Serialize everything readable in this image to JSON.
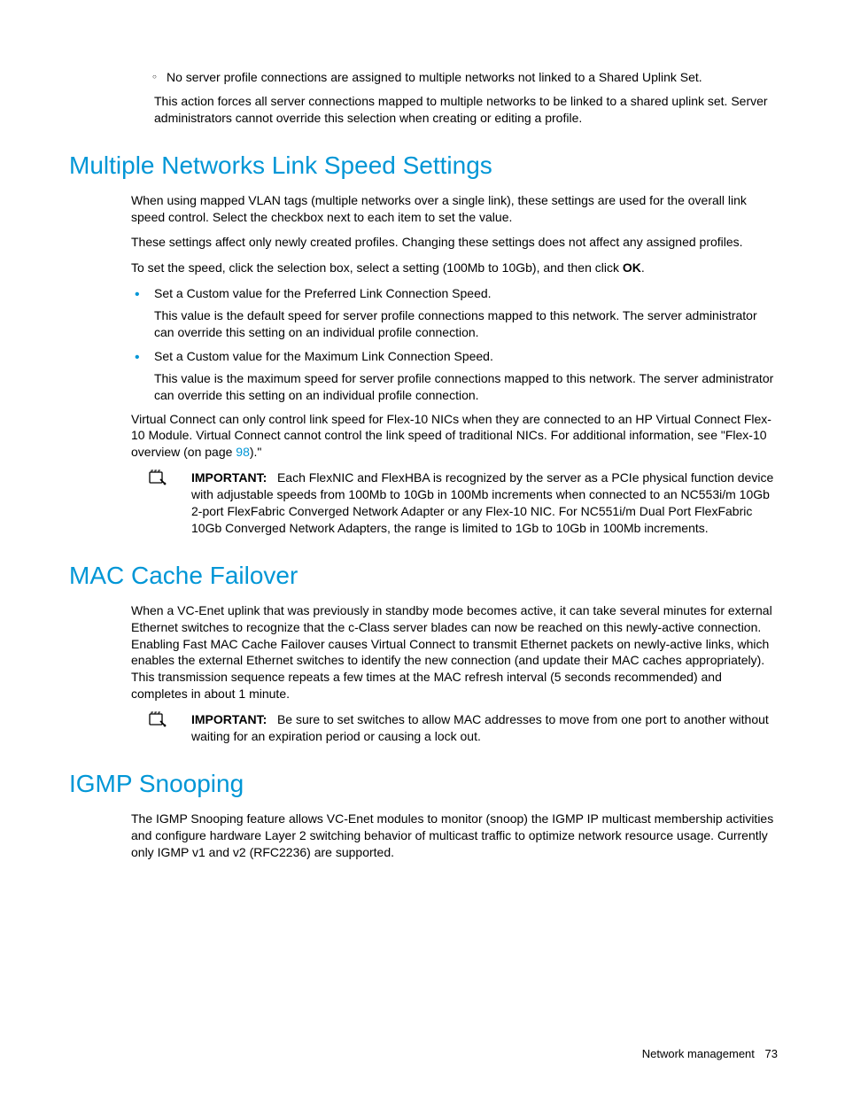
{
  "top": {
    "sub_bullet": "No server profile connections are assigned to multiple networks not linked to a Shared Uplink Set.",
    "after_sub": "This action forces all server connections mapped to multiple networks to be linked to a shared uplink set. Server administrators cannot override this selection when creating or editing a profile."
  },
  "section1": {
    "title": "Multiple Networks Link Speed Settings",
    "p1": "When using mapped VLAN tags (multiple networks over a single link), these settings are used for the overall link speed control. Select the checkbox next to each item to set the value.",
    "p2": "These settings affect only newly created profiles. Changing these settings does not affect any assigned profiles.",
    "p3_pre": "To set the speed, click the selection box, select a setting (100Mb to 10Gb), and then click ",
    "p3_bold": "OK",
    "p3_post": ".",
    "b1": "Set a Custom value for the Preferred Link Connection Speed.",
    "b1_sub": "This value is the default speed for server profile connections mapped to this network. The server administrator can override this setting on an individual profile connection.",
    "b2": "Set a Custom value for the Maximum Link Connection Speed.",
    "b2_sub": "This value is the maximum speed for server profile connections mapped to this network. The server administrator can override this setting on an individual profile connection.",
    "p4_pre": "Virtual Connect can only control link speed for Flex-10 NICs when they are connected to an HP Virtual Connect Flex-10 Module. Virtual Connect cannot control the link speed of traditional NICs. For additional information, see \"Flex-10 overview (on page ",
    "p4_link": "98",
    "p4_post": ").\"",
    "note_label": "IMPORTANT:",
    "note_body": "Each FlexNIC and FlexHBA is recognized by the server as a PCIe physical function device with adjustable speeds from 100Mb to 10Gb in 100Mb increments when connected to an NC553i/m 10Gb 2-port FlexFabric Converged Network Adapter or any Flex-10 NIC. For NC551i/m Dual Port FlexFabric 10Gb Converged Network Adapters, the range is limited to 1Gb to 10Gb in 100Mb increments."
  },
  "section2": {
    "title": "MAC Cache Failover",
    "p1": "When a VC-Enet uplink that was previously in standby mode becomes active, it can take several minutes for external Ethernet switches to recognize that the c-Class server blades can now be reached on this newly-active connection. Enabling Fast MAC Cache Failover causes Virtual Connect to transmit Ethernet packets on newly-active links, which enables the external Ethernet switches to identify the new connection (and update their MAC caches appropriately). This transmission sequence repeats a few times at the MAC refresh interval (5 seconds recommended) and completes in about 1 minute.",
    "note_label": "IMPORTANT:",
    "note_body": "Be sure to set switches to allow MAC addresses to move from one port to another without waiting for an expiration period or causing a lock out."
  },
  "section3": {
    "title": "IGMP Snooping",
    "p1": "The IGMP Snooping feature allows VC-Enet modules to monitor (snoop) the IGMP IP multicast membership activities and configure hardware Layer 2 switching behavior of multicast traffic to optimize network resource usage. Currently only IGMP v1 and v2 (RFC2236) are supported."
  },
  "footer": {
    "section": "Network management",
    "page": "73"
  }
}
